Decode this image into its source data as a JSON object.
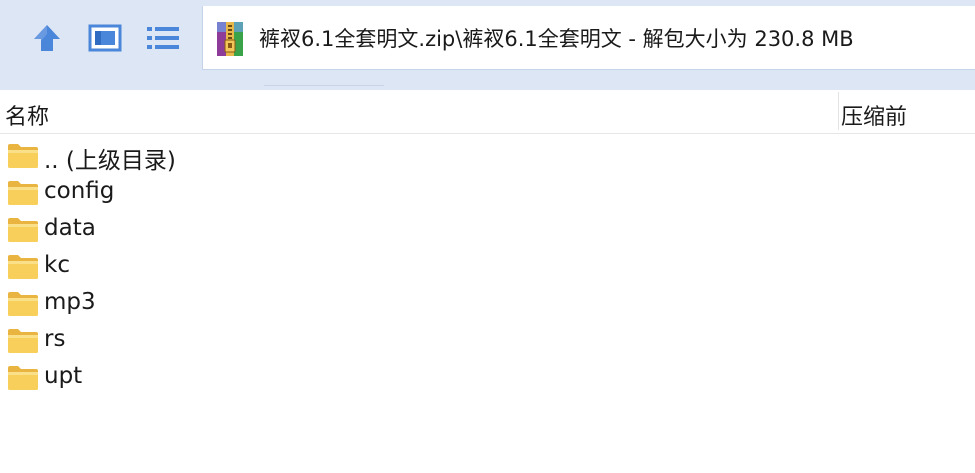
{
  "toolbar": {
    "up_icon": "arrow-up-icon",
    "view_icon": "window-view-icon",
    "list_icon": "list-view-icon",
    "archive_icon": "winrar-archive-icon",
    "path": "裤衩6.1全套明文.zip\\裤衩6.1全套明文 - 解包大小为 230.8 MB"
  },
  "columns": {
    "name": "名称",
    "size": "压缩前"
  },
  "files": [
    {
      "name": ".. (上级目录)",
      "icon": "folder-icon"
    },
    {
      "name": "config",
      "icon": "folder-icon"
    },
    {
      "name": "data",
      "icon": "folder-icon"
    },
    {
      "name": "kc",
      "icon": "folder-icon"
    },
    {
      "name": "mp3",
      "icon": "folder-icon"
    },
    {
      "name": "rs",
      "icon": "folder-icon"
    },
    {
      "name": "upt",
      "icon": "folder-icon"
    }
  ],
  "colors": {
    "toolbar_bg": "#dce6f5",
    "icon_blue": "#4a86d9",
    "folder_yellow": "#f8cf5a"
  }
}
